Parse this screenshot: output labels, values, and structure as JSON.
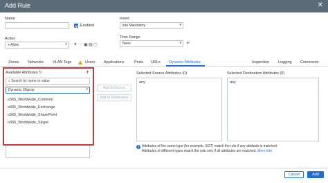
{
  "dialog": {
    "title": "Add Rule"
  },
  "name": {
    "label": "Name",
    "value": "",
    "enabled_label": "Enabled"
  },
  "insert": {
    "label": "Insert",
    "value": "into Mandatory"
  },
  "action": {
    "label": "Action",
    "value": "Allow"
  },
  "time_range": {
    "label": "Time Range",
    "value": "None"
  },
  "tabs": [
    "Zones",
    "Networks",
    "VLAN Tags",
    "Users",
    "Applications",
    "Ports",
    "URLs",
    "Dynamic Attributes",
    "Inspection",
    "Logging",
    "Comments"
  ],
  "available": {
    "header": "Available Attributes",
    "search_placeholder": "Search by name or value",
    "type_value": "Dynamic Objects",
    "items": [
      "o365_Worldwide_Common",
      "o365_Worldwide_Exchange",
      "o365_Worldwide_SharePoint",
      "o365_Worldwide_Skype"
    ]
  },
  "buttons": {
    "add_to_source": "Add to Source",
    "add_to_destination": "Add to Destination",
    "cancel": "Cancel",
    "add": "Add"
  },
  "source": {
    "header": "Selected Source Attributes (0)",
    "placeholder": "any"
  },
  "destination": {
    "header": "Selected Destination Attributes (0)",
    "placeholder": "any"
  },
  "info": {
    "line1": "Attributes of the same type (for example, SGT) match the rule if any attribute is matched.",
    "line2": "Attributes of different types match the rule only if all attributes are matched.",
    "link": "More info"
  },
  "colors": {
    "accent": "#1e6fd9",
    "highlight": "#d6323a",
    "titlebar": "#5b6a77",
    "allow": "#2e9c4a",
    "warning": "#e8a317"
  }
}
